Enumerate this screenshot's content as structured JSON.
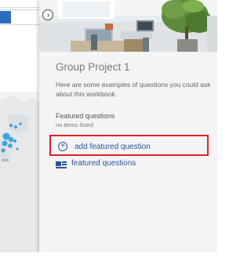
{
  "panel": {
    "title": "Group Project 1",
    "description": "Here are some examples of questions you could ask about this workbook.",
    "featured_heading": "Featured questions",
    "featured_empty": "no items listed",
    "add_label": "add featured question",
    "featured_link": "featured questions"
  },
  "background": {
    "map_label": "ston"
  },
  "icons": {
    "collapse": "chevron-right-circle-icon",
    "add": "plus-circle-icon",
    "featured": "featured-questions-icon"
  },
  "colors": {
    "link_blue": "#2b5797",
    "highlight_red": "#e0202a",
    "panel_bg": "#f4f4f4",
    "map_bubble": "#3aa7e0"
  }
}
